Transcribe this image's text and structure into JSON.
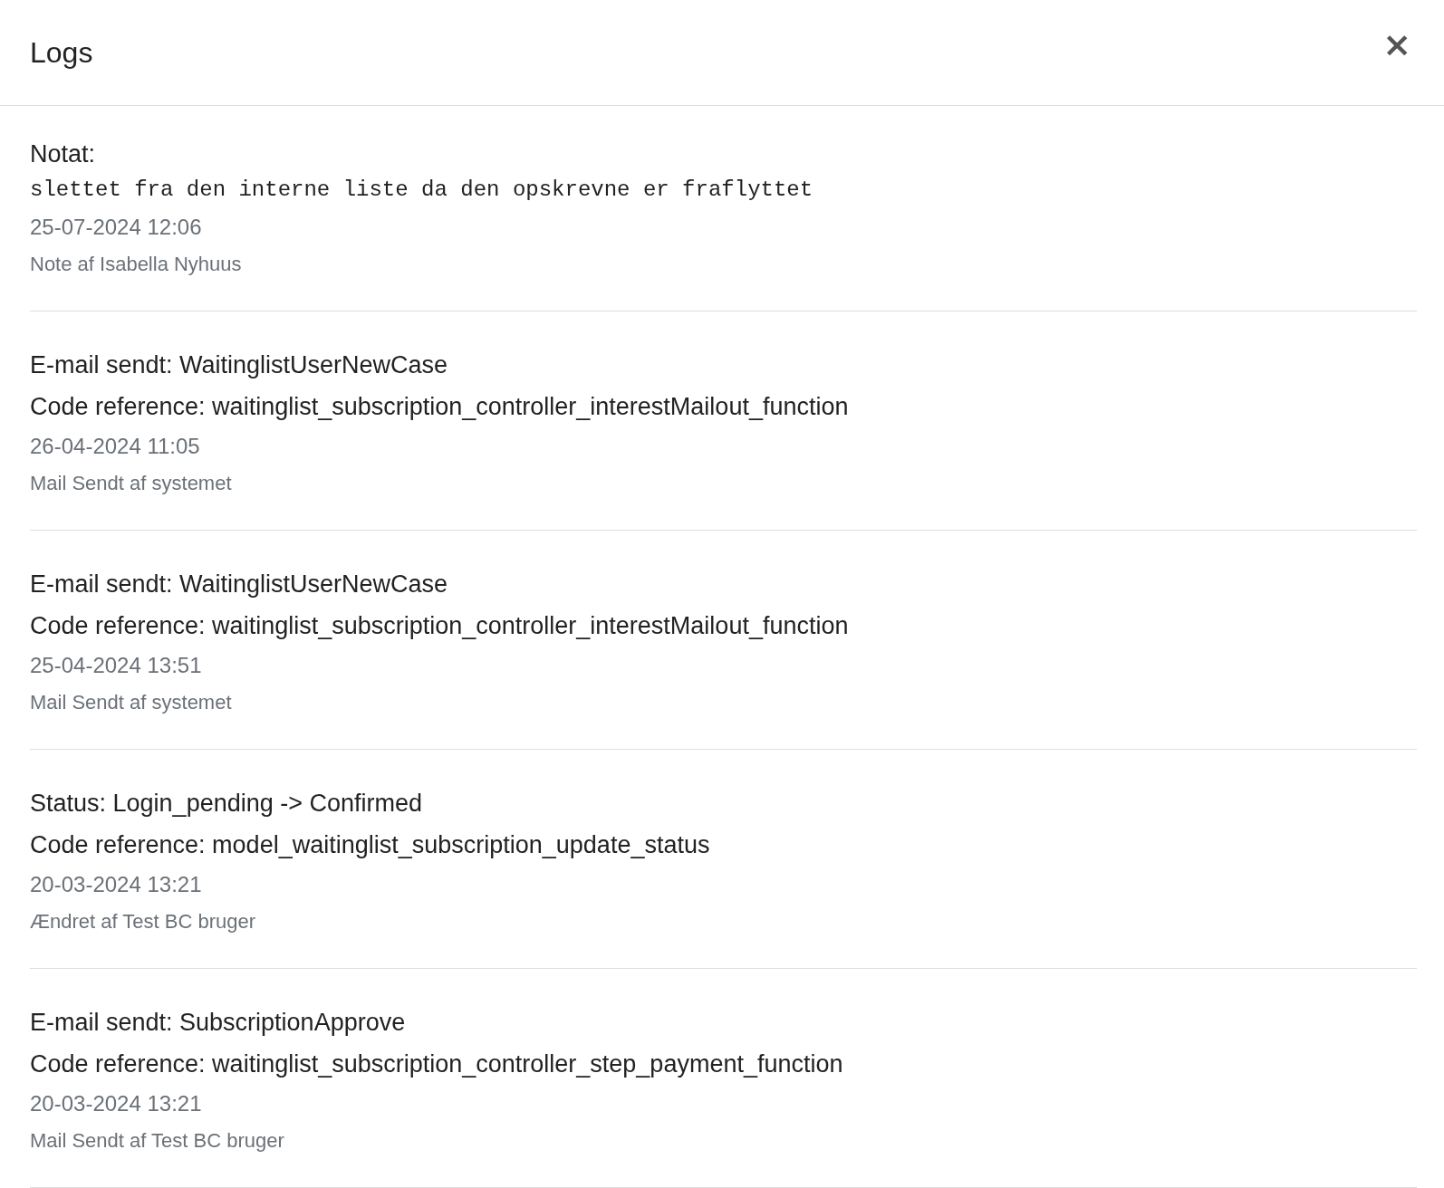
{
  "dialog": {
    "title": "Logs",
    "close": "×"
  },
  "entries": [
    {
      "kind": "note",
      "heading": "Notat:",
      "text": "slettet fra den interne liste da den opskrevne er fraflyttet",
      "date": "25-07-2024 12:06",
      "author": "Note af Isabella Nyhuus"
    },
    {
      "kind": "event",
      "heading": "E-mail sendt: WaitinglistUserNewCase",
      "text": "Code reference: waitinglist_subscription_controller_interestMailout_function",
      "date": "26-04-2024 11:05",
      "author": "Mail Sendt af systemet"
    },
    {
      "kind": "event",
      "heading": "E-mail sendt: WaitinglistUserNewCase",
      "text": "Code reference: waitinglist_subscription_controller_interestMailout_function",
      "date": "25-04-2024 13:51",
      "author": "Mail Sendt af systemet"
    },
    {
      "kind": "event",
      "heading": "Status: Login_pending -> Confirmed",
      "text": "Code reference: model_waitinglist_subscription_update_status",
      "date": "20-03-2024 13:21",
      "author": "Ændret af Test BC bruger"
    },
    {
      "kind": "event",
      "heading": "E-mail sendt: SubscriptionApprove",
      "text": "Code reference: waitinglist_subscription_controller_step_payment_function",
      "date": "20-03-2024 13:21",
      "author": "Mail Sendt af Test BC bruger"
    }
  ]
}
